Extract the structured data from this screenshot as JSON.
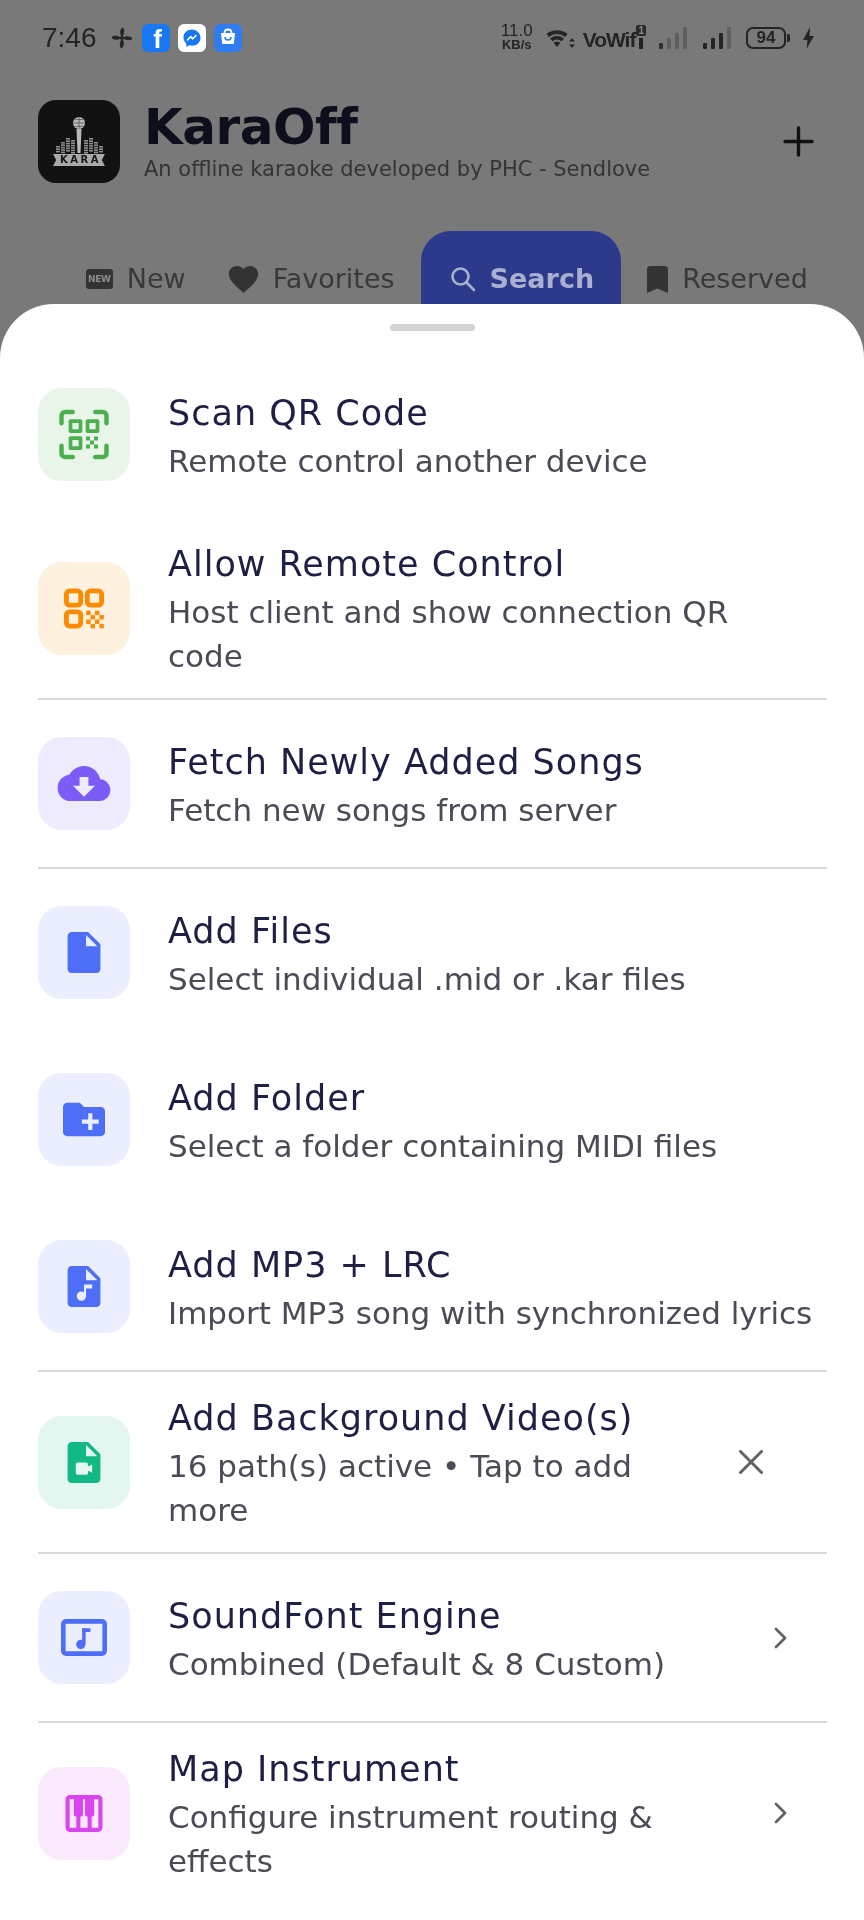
{
  "status_bar": {
    "time": "7:46",
    "notifications": [
      {
        "kind": "fan"
      },
      {
        "kind": "letter",
        "glyph": "f"
      },
      {
        "kind": "chat"
      },
      {
        "kind": "bag"
      }
    ],
    "net_speed": {
      "value": "11.0",
      "unit": "KB/s"
    },
    "wifi_calling": "VoWif",
    "sim_slot": "1",
    "battery": "94"
  },
  "app_bar": {
    "logo_label": "KARA",
    "title": "KaraOff",
    "subtitle": "An offline karaoke developed by PHC - Sendlove"
  },
  "tabs": [
    {
      "kind": "new",
      "badge": "NEW",
      "label": "New",
      "selected": false
    },
    {
      "kind": "favorite",
      "label": "Favorites",
      "selected": false
    },
    {
      "kind": "search",
      "label": "Search",
      "selected": true
    },
    {
      "kind": "bookmark",
      "label": "Reserved",
      "selected": false
    }
  ],
  "sheet": {
    "sections": [
      {
        "items": [
          {
            "kind": "scan",
            "color": "#4caf50",
            "title": "Scan QR Code",
            "subtitle": "Remote control another device",
            "removable": false,
            "opens_submenu": false
          },
          {
            "kind": "qr",
            "color": "#fb8c00",
            "title": "Allow Remote Control",
            "subtitle": "Host client and show connection QR code",
            "removable": false,
            "opens_submenu": false
          }
        ]
      },
      {
        "items": [
          {
            "kind": "download",
            "color": "#7c5cf6",
            "title": "Fetch Newly Added Songs",
            "subtitle": "Fetch new songs from server",
            "removable": false,
            "opens_submenu": false
          }
        ]
      },
      {
        "items": [
          {
            "kind": "file",
            "color": "#4f6ef7",
            "title": "Add Files",
            "subtitle": "Select individual .mid or .kar files",
            "removable": false,
            "opens_submenu": false
          },
          {
            "kind": "folder",
            "color": "#4f6ef7",
            "title": "Add Folder",
            "subtitle": "Select a folder containing MIDI files",
            "removable": false,
            "opens_submenu": false
          },
          {
            "kind": "audio",
            "color": "#4f6ef7",
            "title": "Add MP3 + LRC",
            "subtitle": "Import MP3 song with synchronized lyrics",
            "removable": false,
            "opens_submenu": false
          }
        ]
      },
      {
        "items": [
          {
            "kind": "video",
            "color": "#12b886",
            "title": "Add Background Video(s)",
            "subtitle": "16 path(s) active • Tap to add more",
            "removable": true,
            "opens_submenu": false
          }
        ]
      },
      {
        "items": [
          {
            "kind": "soundfont",
            "color": "#4f6ef7",
            "title": "SoundFont Engine",
            "subtitle": "Combined (Default & 8 Custom)",
            "removable": false,
            "opens_submenu": true
          }
        ]
      },
      {
        "items": [
          {
            "kind": "piano",
            "color": "#d946ef",
            "title": "Map Instrument",
            "subtitle": "Configure instrument routing & effects",
            "removable": false,
            "opens_submenu": true
          }
        ]
      }
    ]
  }
}
